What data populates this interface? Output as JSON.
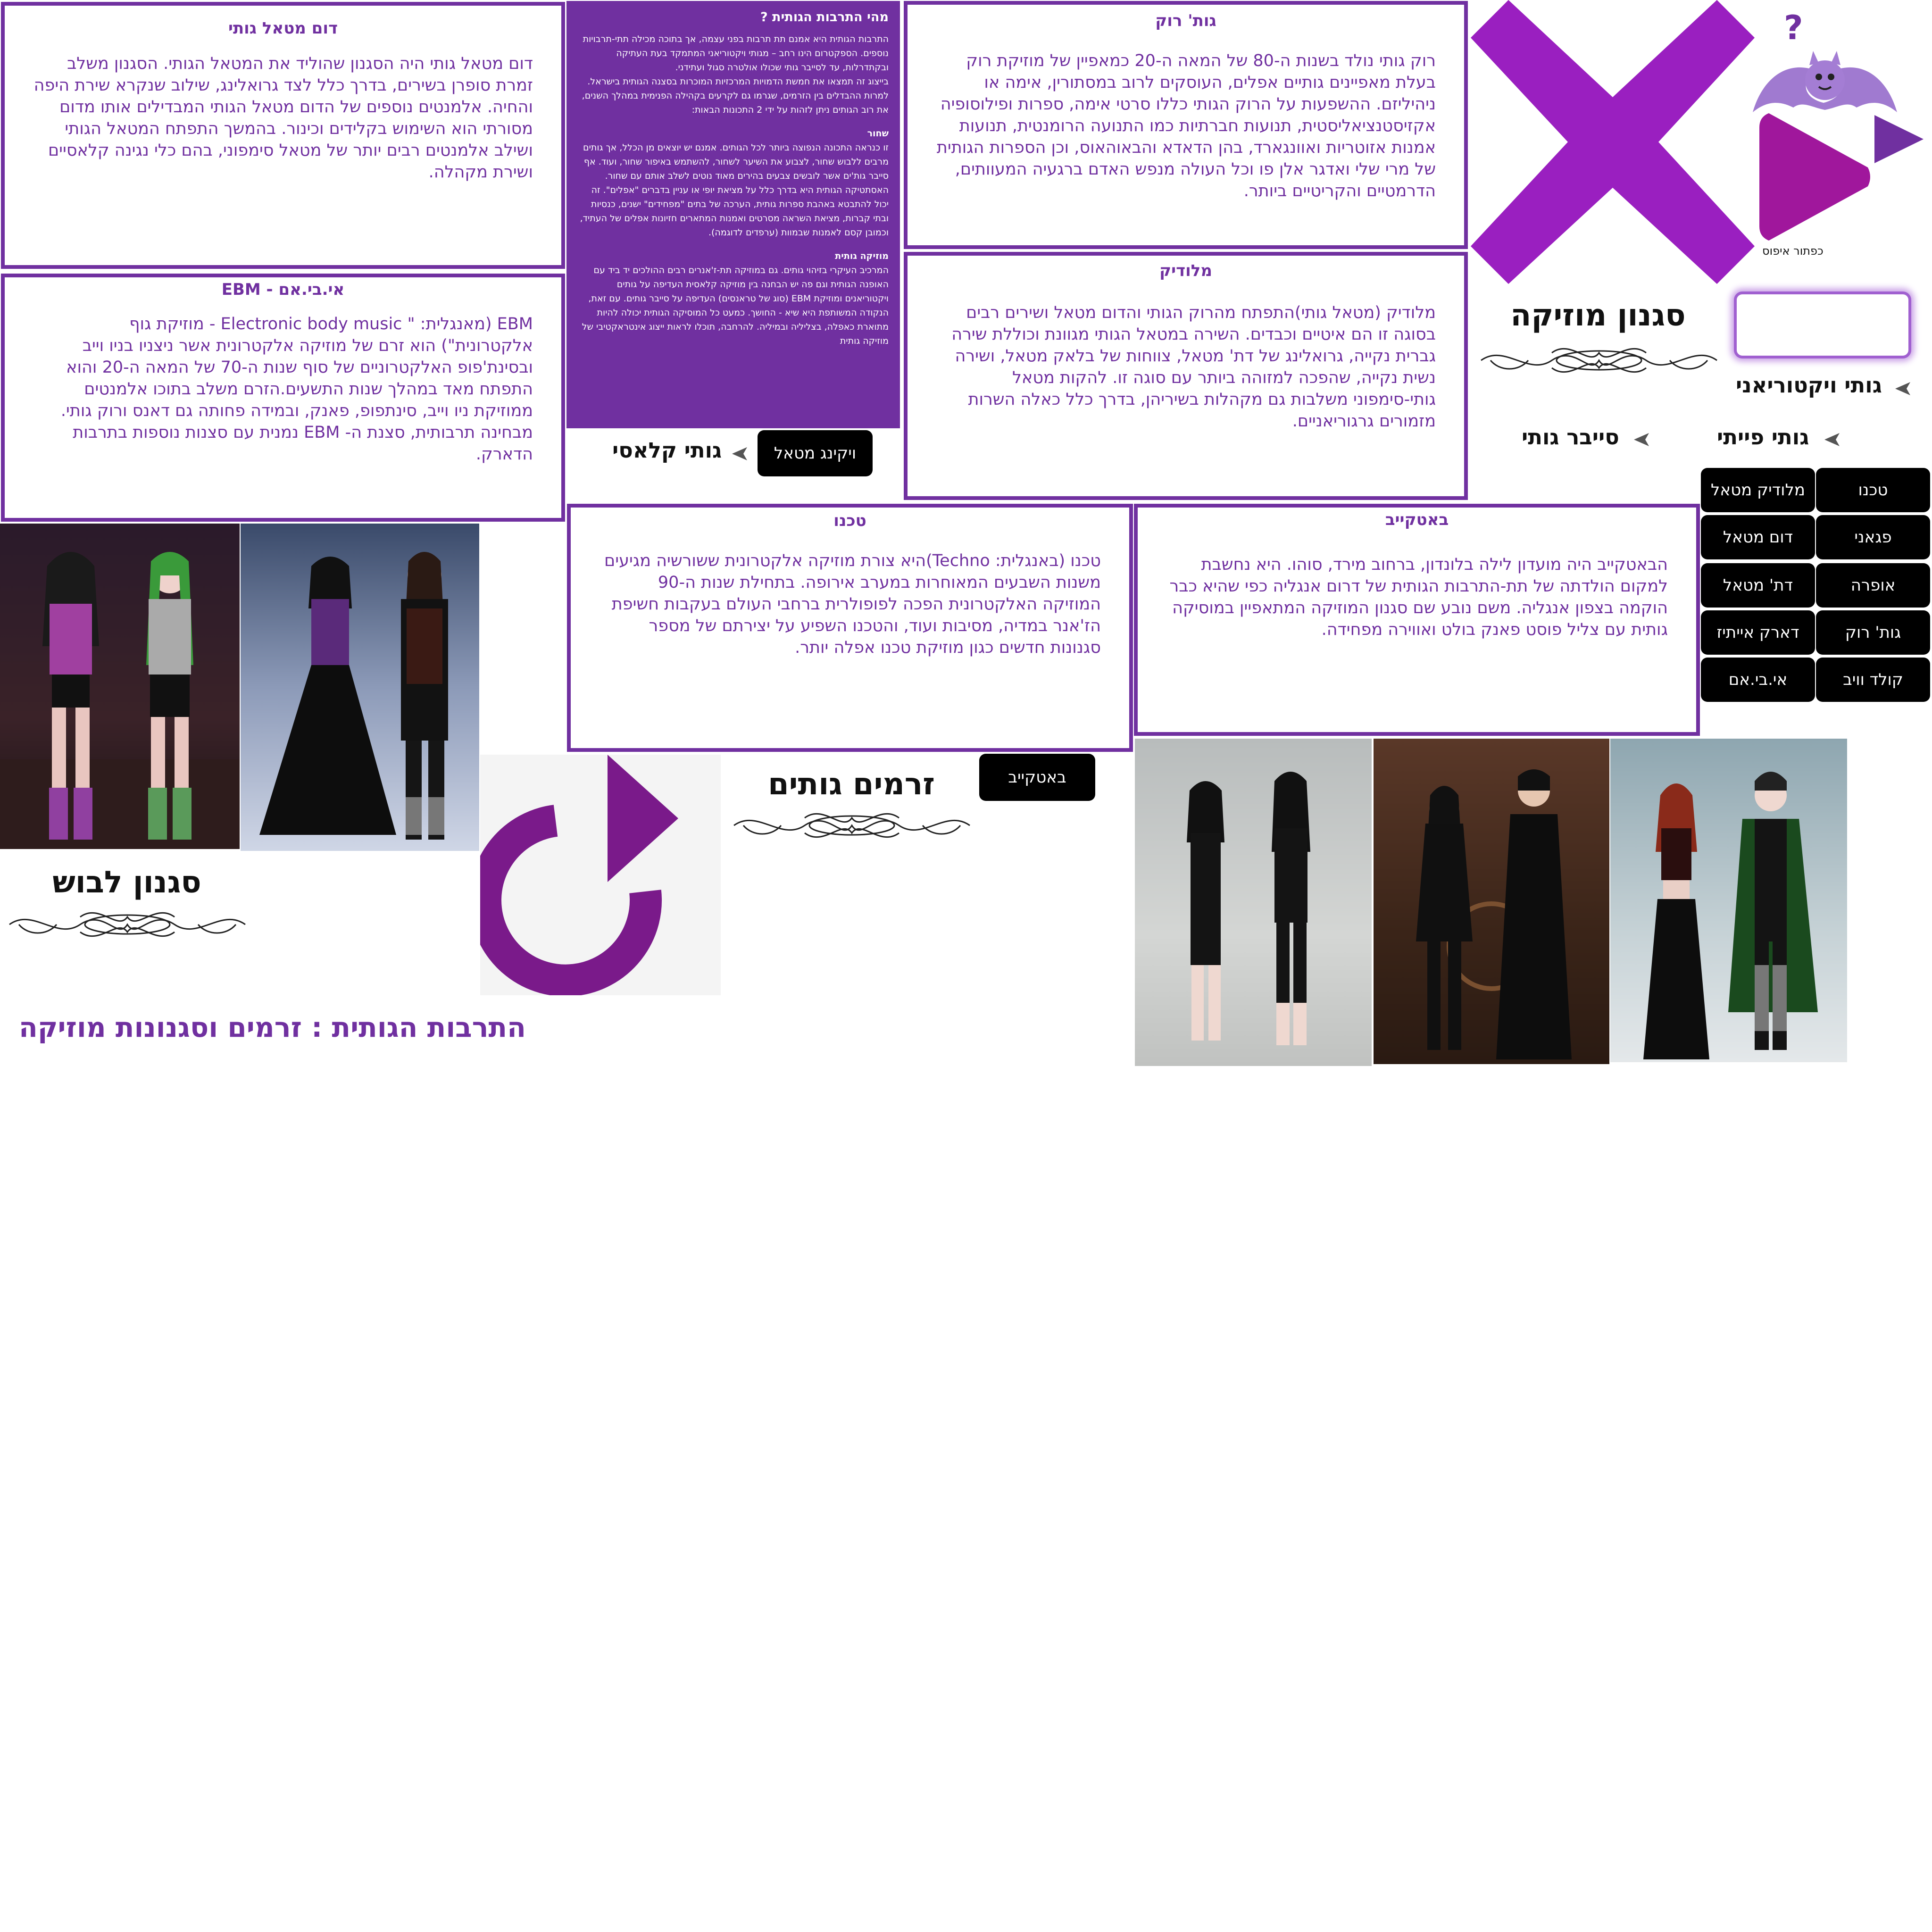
{
  "boxes": {
    "doom": {
      "title": "דום מטאל גותי",
      "body": "דום מטאל גותי היה הסגנון שהוליד את המטאל הגותי. הסגנון משלב זמרת סופרן בשירים, בדרך כלל לצד גרואלינג, שילוב שנקרא שירת היפה והחיה. אלמנטים נוספים של הדום מטאל הגותי המבדילים אותו מדום מסורתי הוא השימוש בקלידים וכינור. בהמשך התפתח המטאל הגותי ושילב אלמנטים רבים יותר של מטאל סימפוני, בהם כלי נגינה קלאסיים ושירת מקהלה."
    },
    "ebm": {
      "title": "אי.בי.אם - EBM",
      "body": "EBM (מאנגלית: \" Electronic body music - מוזיקת גוף אלקטרונית\") הוא זרם של מוזיקה אלקטרונית אשר ניצניו בניו וייב ובסינת'פופ האלקטרוניים של סוף שנות ה-70 של המאה ה-20 והוא התפתח מאד במהלך שנות התשעים.הזרם משלב בתוכו אלמנטים ממוזיקת ניו וייב, סינתפופ, פאנק, ובמידה פחותה גם דאנס ורוק גותי. מבחינה תרבותית, סצנת ה- EBM נמנית עם סצנות נוספות בתרבות הדארק."
    },
    "gothrock": {
      "title": "גות' רוק",
      "body": "רוק גותי נולד בשנות ה-80 של המאה ה-20 כמאפיין של מוזיקת רוק בעלת מאפיינים גותיים אפלים, העוסקים לרוב במסתורין, אימה או ניהיליזם. ההשפעות על הרוק הגותי כללו סרטי אימה, ספרות ופילוסופיה אקזיסטנציאליסטית, תנועות חברתיות כמו התנועה הרומנטית, תנועות אמנות אזוטריות ואוונגארד, בהן הדאדא והבאוהאוס, וכן הספרות הגותית של מרי שלי ואדגר אלן פו וכל העולה מנפש האדם ברגעיה המעוותים, הדרמטיים והקריטיים ביותר."
    },
    "melodic": {
      "title": "מלודיק",
      "body": "מלודיק (מטאל גותי)התפתח מהרוק הגותי והדום מטאל ושירים רבים בסוגה זו הם איטיים וכבדים. השירה במטאל הגותי מגוונת וכוללת שירה גברית נקייה, גרואלינג של דת' מטאל, צווחות של בלאק מטאל, ושירה נשית נקייה, שהפכה למזוהה ביותר עם סוגה זו. להקות מטאל גותי-סימפוני משלבות גם מקהלות בשיריהן, בדרך כלל כאלה השרות מזמורים גרגוריאניים."
    },
    "techno": {
      "title": "טכנו",
      "body": "טכנו (באנגלית: Techno)היא צורת מוזיקה אלקטרונית ששורשיה מגיעים משנות השבעים המאוחרות במערב אירופה. בתחילת שנות ה-90 המוזיקה האלקטרונית הפכה לפופולרית ברחבי העולם בעקבות חשיפת הז'אנר במדיה, מסיבות ועוד, והטכנו השפיע על יצירתם של מספר סגנונות חדשים כגון מוזיקת טכנו אפלה יותר."
    },
    "batcave": {
      "title": "באטקייב",
      "body": "הבאטקייב היה מועדון לילה בלונדון, ברחוב מירד, סוהו. היא נחשבת למקום הולדתה של תת-התרבות הגותית של דרום אנגליה כפי שהיא כבר הוקמה בצפון אנגליה. משם נובע שם סגנון המוזיקה המתאפיין במוסיקה גותית עם צליל פוסט פאנק בולט ואווירה מפחידה."
    }
  },
  "intro": {
    "title": "מהי התרבות הגותית ?",
    "p1": "התרבות הגותית היא אמנם תת תרבות בפני עצמה, אך בתוכה מכילה תתי-תרבויות נוספים. הספקטרום הינו רחב – מגותי ויקטוריאני המתמקד בעת העתיקה ובקתדרלות, עד לסייבר גותי שכולו אולטרה סגול ועתידני.",
    "p2": "בייצוג זה תמצאו את חמשת הדמויות המרכזיות המוכרות בסצנה הגותית בישראל. למרות ההבדלים בין הזרמים, שגרמו גם לקרעים בקהילה הפנימית במהלך השנים, את רוב הגותים ניתן לזהות על ידי 2 התכונות הבאות:",
    "h_black": "שחור",
    "p_black": "זו כנראה התכונה הנפוצה ביותר לכל הגותים. אמנם יש יוצאים מן הכלל, אך גותים מרבים ללבוש שחור, לצבוע את השיער לשחור, להשתמש באיפור שחור, ועוד. אף סייבר גות'ים אשר לובשים צבעים בהירים מאוד נוטים לשלב אותם עם שחור. האסתטיקה הגותית היא בדרך כלל על מציאת יופי או עניין בדברים \"אפלים\". זה יכול להתבטא באהבת ספרות גותית, הערכה של בתים \"מפחידים\" ישנים, כנסיות ובתי קברות, מציאת השראה מסרטים ואמנות המתארים חזיונות אפלים של העתיד, וכמובן קסם לאמנות שבמוות (ערפדים לדוגמה).",
    "h_music": "מוזיקה גותית",
    "p_music": "המרכיב העיקרי בזיהוי גותים. גם במוזיקה תת-ז'אנרים רבים ההולכים יד ביד עם האופנה הגותית וגם פה יש הבחנה בין מוזיקה קלאסית העדיפה על גותים ויקטוריאנים ומוזיקת EBM (סוג של טראנסים) העדיפה על סייבר גותים. עם זאת, הנקודה המשותפת היא שיא - החושך. כמעט כל המוסיקה הגותית יכולה להיות מתוארת כאפלה, בצליליה ובמיליה. להרחבה, תוכלו לראות ייצוג אינטראקטיבי של מוזיקה גותית"
  },
  "sections": {
    "music": "סגנון מוזיקה",
    "streams": "זרמים גותים",
    "clothing": "סגנון לבוש"
  },
  "subcultures": {
    "victorian": "גותי ויקטוריאני",
    "fairy": "גותי פייתי",
    "cyber": "סייבר גותי",
    "classic": "גותי קלאסי"
  },
  "music_buttons": [
    [
      "טכנו",
      "מלודיק מטאל"
    ],
    [
      "פגאני",
      "דום מטאל"
    ],
    [
      "אופרה",
      "דת' מטאל"
    ],
    [
      "גות' רוק",
      "דארק אייתיז"
    ],
    [
      "קולד וויב",
      "אי.בי.אם"
    ]
  ],
  "viking_button": "ויקינג מטאל",
  "batcave_button": "באטקייב",
  "reset_label": "כפתור איפוס",
  "help_mark": "?",
  "footer_title": "התרבות הגותית : זרמים וסגנונות מוזיקה",
  "colors": {
    "accent": "#7030a0",
    "purple_x": "#9a1fc0",
    "magenta": "#a0179c"
  }
}
